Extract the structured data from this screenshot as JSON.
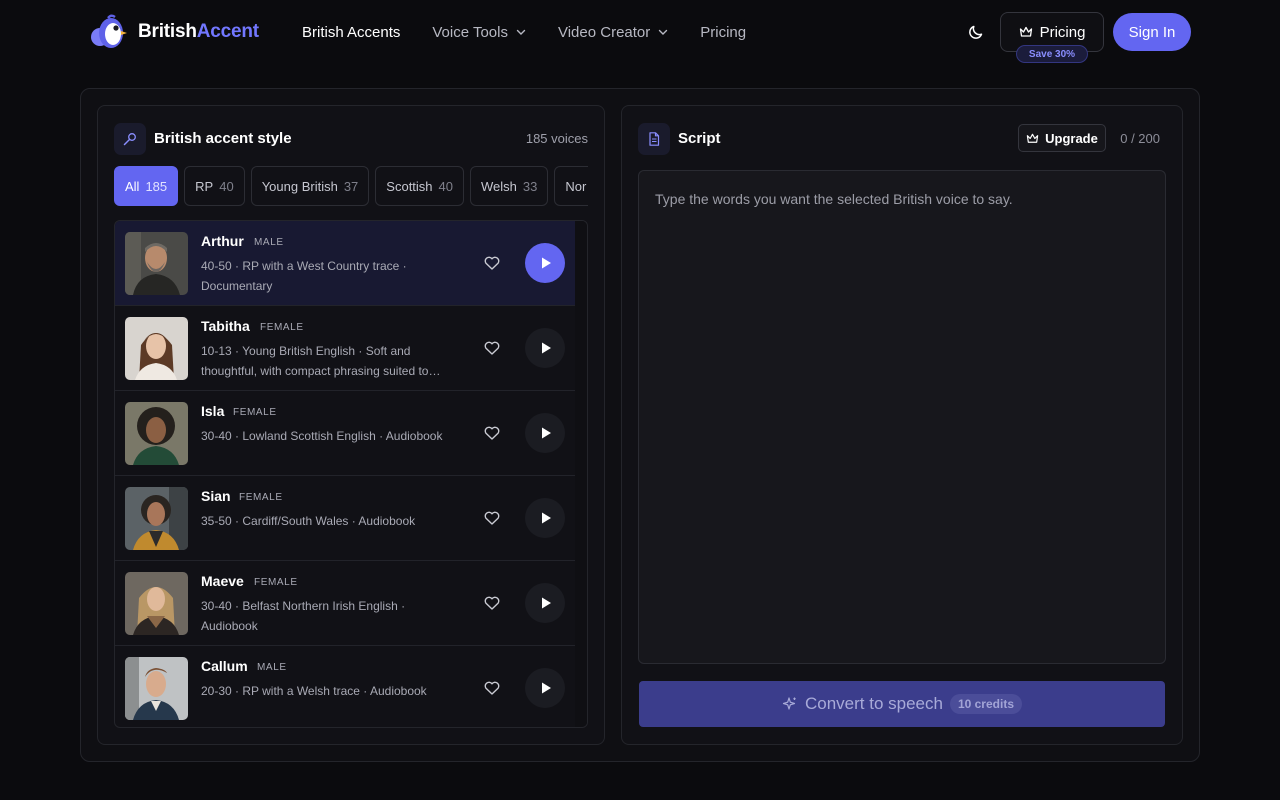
{
  "brand": {
    "name_part1": "British",
    "name_part2": "Accent"
  },
  "nav": {
    "items": [
      {
        "label": "British Accents",
        "active": true,
        "has_dropdown": false
      },
      {
        "label": "Voice Tools",
        "active": false,
        "has_dropdown": true
      },
      {
        "label": "Video Creator",
        "active": false,
        "has_dropdown": true
      },
      {
        "label": "Pricing",
        "active": false,
        "has_dropdown": false
      }
    ],
    "theme_toggle_icon": "moon-icon",
    "pricing_button": "Pricing",
    "pricing_badge": "Save 30%",
    "signin_button": "Sign In"
  },
  "voices_panel": {
    "title": "British accent style",
    "count_label": "185 voices",
    "filters": [
      {
        "label": "All",
        "count": "185",
        "active": true
      },
      {
        "label": "RP",
        "count": "40",
        "active": false
      },
      {
        "label": "Young British",
        "count": "37",
        "active": false
      },
      {
        "label": "Scottish",
        "count": "40",
        "active": false
      },
      {
        "label": "Welsh",
        "count": "33",
        "active": false
      },
      {
        "label": "Nor",
        "count": "",
        "active": false
      }
    ],
    "voices": [
      {
        "name": "Arthur",
        "gender": "MALE",
        "description": "40-50 · RP with a West Country trace · Documentary",
        "selected": true
      },
      {
        "name": "Tabitha",
        "gender": "FEMALE",
        "description": "10-13 · Young British English · Soft and thoughtful, with compact phrasing suited to…",
        "selected": false
      },
      {
        "name": "Isla",
        "gender": "FEMALE",
        "description": "30-40 · Lowland Scottish English · Audiobook",
        "selected": false
      },
      {
        "name": "Sian",
        "gender": "FEMALE",
        "description": "35-50 · Cardiff/South Wales · Audiobook",
        "selected": false
      },
      {
        "name": "Maeve",
        "gender": "FEMALE",
        "description": "30-40 · Belfast Northern Irish English · Audiobook",
        "selected": false
      },
      {
        "name": "Callum",
        "gender": "MALE",
        "description": "20-30 · RP with a Welsh trace · Audiobook",
        "selected": false
      }
    ]
  },
  "script_panel": {
    "title": "Script",
    "upgrade_button": "Upgrade",
    "char_count": "0 / 200",
    "placeholder": "Type the words you want the selected British voice to say.",
    "value": "",
    "convert_button": "Convert to speech",
    "credits": "10 credits"
  },
  "colors": {
    "accent": "#6366f1",
    "background": "#0b0b0e",
    "panel": "#111116"
  }
}
